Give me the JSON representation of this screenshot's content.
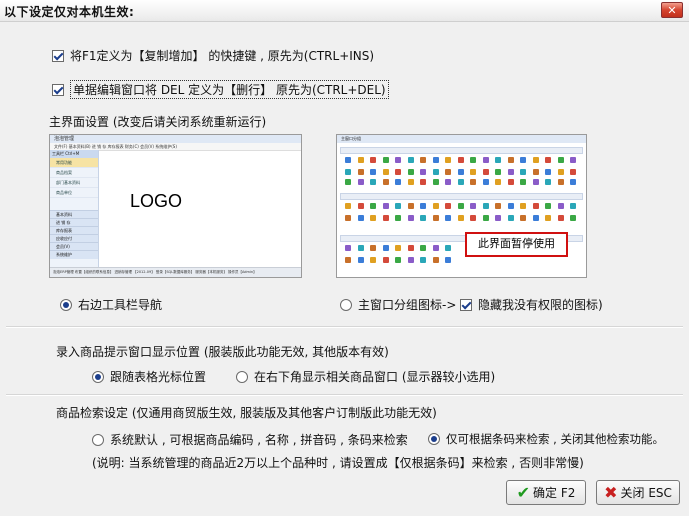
{
  "window": {
    "title": "以下设定仅对本机生效:",
    "close_label": "✕"
  },
  "options": {
    "f1_shortcut": {
      "label": "将F1定义为【复制增加】 的快捷键 , 原先为(CTRL+INS)",
      "checked": true
    },
    "del_shortcut": {
      "label": "单据编辑窗口将 DEL 定义为【删行】  原先为(CTRL+DEL)",
      "checked": true
    }
  },
  "main_ui": {
    "heading": "主界面设置 (改变后请关闭系统重新运行)",
    "left_preview": {
      "window_title": "泡泡管理",
      "menu": "文件(F)  基本资料(B)  进 销 存  库存报表  财务(C)  会员(V)  系统维护(S)",
      "sidebar_header": "工具栏 Ctrl+M",
      "sidebar_items": [
        "常用功能",
        "商品档案",
        "部门基本资料",
        "商品单位"
      ],
      "sidebar_bottom": [
        "基本资料",
        "进  销  存",
        "库存报表",
        "应收应付",
        "会员(V)",
        "系统维护"
      ],
      "logo": "LOGO",
      "status": "泡泡ERP管理 布置【组织的联系信息】  进销存管理 【2012-09】 登录【SQL数据库服务】 服务器【本机服务】 操作员【Admin】"
    },
    "right_preview": {
      "window_title": "主窗口分组",
      "notice": "此界面暂停使用"
    },
    "radio_toolbar": {
      "label": "右边工具栏导航",
      "checked": true
    },
    "radio_group": {
      "label": "主窗口分组图标->",
      "checked": false
    },
    "hide_no_permission": {
      "label": "隐藏我没有权限的图标)",
      "checked": true
    }
  },
  "product_tip": {
    "heading": "录入商品提示窗口显示位置 (服装版此功能无效, 其他版本有效)",
    "follow_cursor": {
      "label": "跟随表格光标位置",
      "checked": true
    },
    "bottom_right": {
      "label": "在右下角显示相关商品窗口 (显示器较小选用)",
      "checked": false
    }
  },
  "product_search": {
    "heading": "商品检索设定 (仅通用商贸版生效, 服装版及其他客户订制版此功能无效)",
    "system_default": {
      "label": "系统默认 , 可根据商品编码 , 名称 , 拼音码 , 条码来检索",
      "checked": false
    },
    "barcode_only": {
      "label": "仅可根据条码来检索 , 关闭其他检索功能。",
      "checked": true
    },
    "note": "(说明: 当系统管理的商品近2万以上个品种时 , 请设置成【仅根据条码】来检索 , 否则非常慢)"
  },
  "buttons": {
    "ok": "确定 F2",
    "ok_icon": "check-icon",
    "cancel": "关闭 ESC",
    "cancel_icon": "x-icon"
  },
  "colors": {
    "notice_border": "#d01010",
    "radio_fill": "#1c3e8c",
    "close_button": "#d5442f",
    "ok_icon": "#1f9a1f",
    "cancel_icon": "#c82020"
  }
}
